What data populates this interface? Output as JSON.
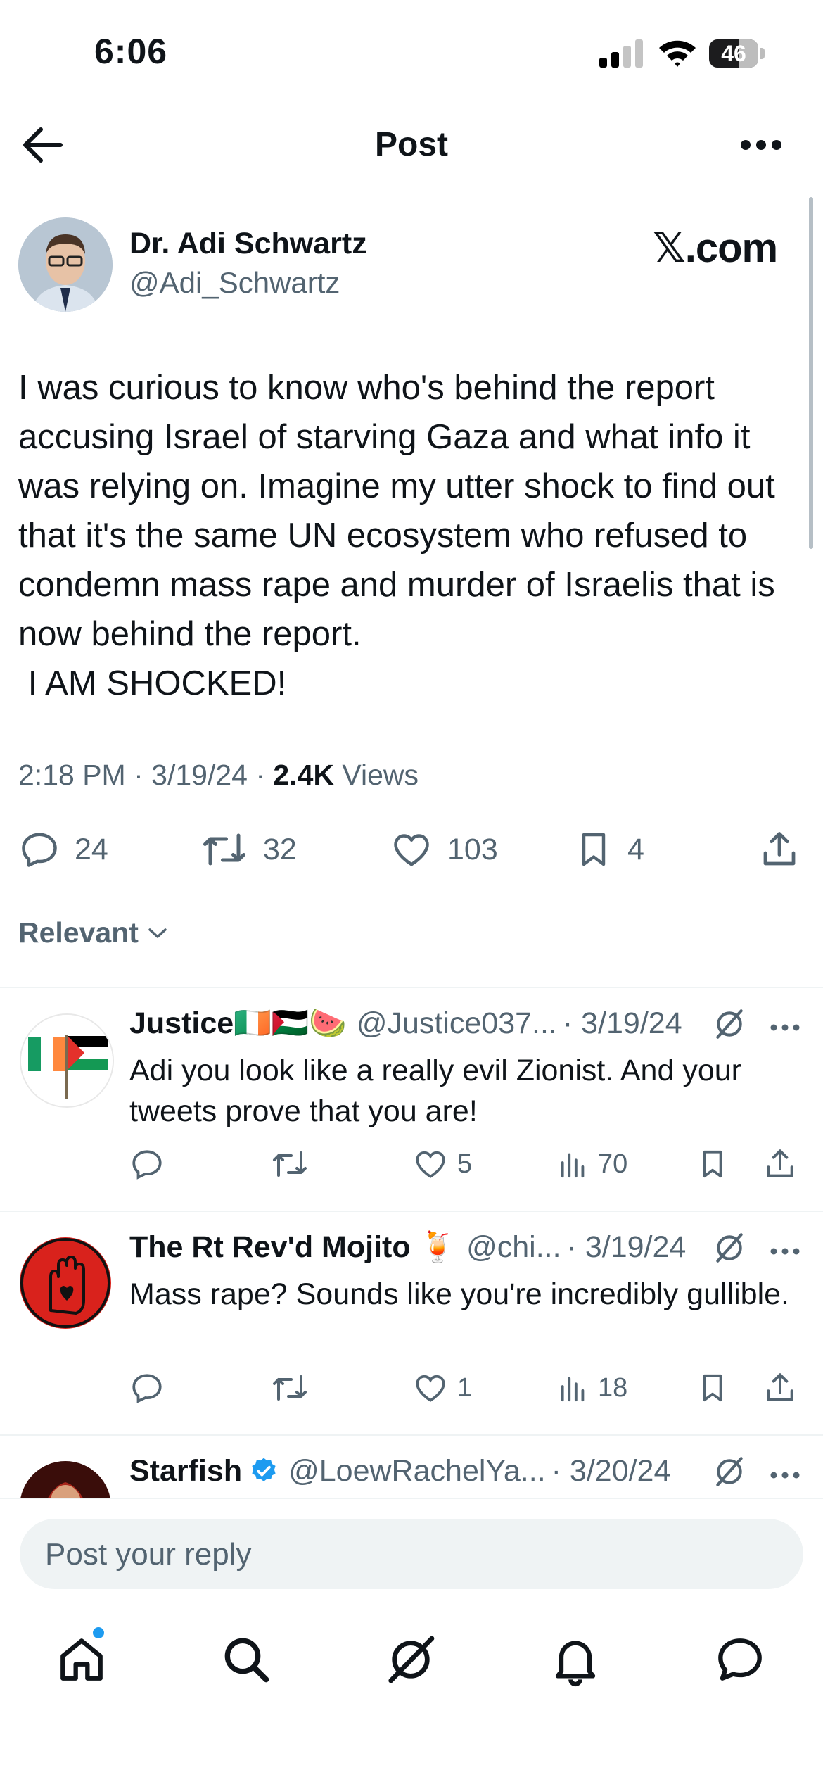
{
  "status_bar": {
    "time": "6:06",
    "battery": "46"
  },
  "header": {
    "title": "Post"
  },
  "post": {
    "author_name": "Dr. Adi Schwartz",
    "author_handle": "@Adi_Schwartz",
    "source_logo": "𝕏.com",
    "text": "I was curious to know who's behind the report accusing Israel of starving Gaza and what info it was relying on. Imagine my utter shock to find out that it's the same UN ecosystem who refused to condemn mass rape and murder of Israelis that is now behind the report.\n I AM SHOCKED!",
    "time": "2:18 PM",
    "date": "3/19/24",
    "views_count": "2.4K",
    "views_label": "Views",
    "replies": "24",
    "reposts": "32",
    "likes": "103",
    "bookmarks": "4"
  },
  "sort": {
    "label": "Relevant"
  },
  "replies": [
    {
      "name": "Justice🇮🇪🇵🇸🍉",
      "handle": "@Justice037...",
      "date": "· 3/19/24",
      "text": "Adi you look like a really evil Zionist. And your tweets prove that you are!",
      "likes": "5",
      "views": "70"
    },
    {
      "name": "The Rt Rev'd Mojito 🍹",
      "handle": "@chi...",
      "date": "· 3/19/24",
      "text": "Mass rape? Sounds like you're incredibly gullible.",
      "likes": "1",
      "views": "18"
    },
    {
      "name": "Starfish",
      "handle": "@LoewRachelYa...",
      "date": "· 3/20/24",
      "verified": true
    }
  ],
  "reply_input": {
    "placeholder": "Post your reply"
  },
  "tabs": [
    "home-icon",
    "search-icon",
    "grok-icon",
    "bell-icon",
    "messages-icon"
  ],
  "colors": {
    "text": "#0f1419",
    "muted": "#536471",
    "accent": "#1d9bf0",
    "divider": "#eff3f4"
  }
}
